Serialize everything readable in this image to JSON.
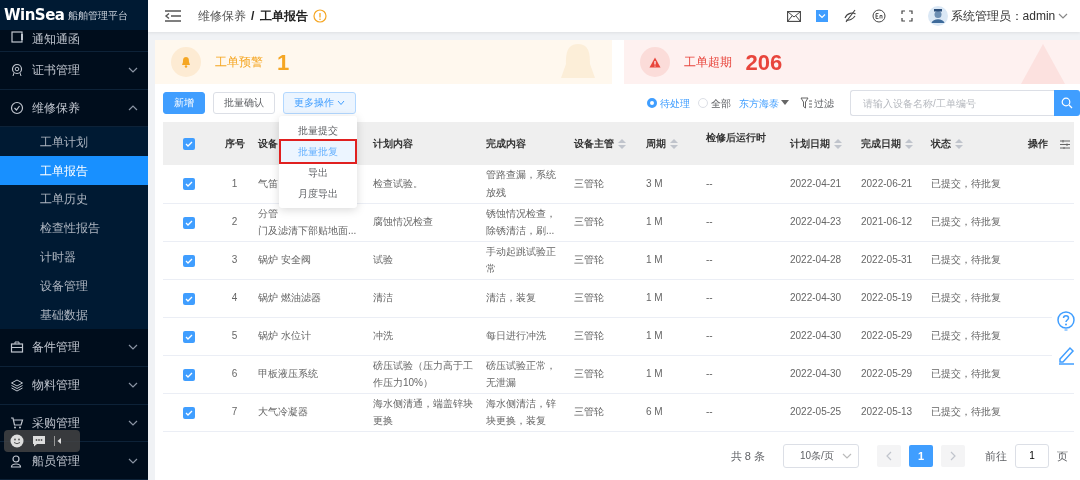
{
  "app": {
    "logo": "WinSea",
    "subtitle": "船舶管理平台"
  },
  "sidebar": {
    "items": [
      {
        "label": "通知通函",
        "kind": "link"
      },
      {
        "label": "证书管理",
        "kind": "group",
        "expanded": false
      },
      {
        "label": "维修保养",
        "kind": "group",
        "expanded": true,
        "children": [
          {
            "label": "工单计划",
            "selected": false
          },
          {
            "label": "工单报告",
            "selected": true
          },
          {
            "label": "工单历史",
            "selected": false
          },
          {
            "label": "检查性报告",
            "selected": false
          },
          {
            "label": "计时器",
            "selected": false
          },
          {
            "label": "设备管理",
            "selected": false
          },
          {
            "label": "基础数据",
            "selected": false
          }
        ]
      },
      {
        "label": "备件管理",
        "kind": "group",
        "expanded": false
      },
      {
        "label": "物料管理",
        "kind": "group",
        "expanded": false
      },
      {
        "label": "采购管理",
        "kind": "group",
        "expanded": false
      },
      {
        "label": "船员管理",
        "kind": "group",
        "expanded": false
      }
    ]
  },
  "header": {
    "breadcrumb": [
      "维修保养",
      "工单报告"
    ],
    "breadcrumb_separator": "/",
    "user": "系统管理员：admin"
  },
  "stats": [
    {
      "label": "工单预警",
      "value": "1",
      "kind": "warning"
    },
    {
      "label": "工单超期",
      "value": "206",
      "kind": "overdue"
    }
  ],
  "toolbar": {
    "buttons": [
      {
        "label": "新增",
        "kind": "primary"
      },
      {
        "label": "批量确认",
        "kind": "default"
      },
      {
        "label": "更多操作",
        "kind": "dropdown",
        "expanded": true
      }
    ],
    "menu": [
      {
        "label": "批量提交",
        "selected": false,
        "annotated": false
      },
      {
        "label": "批量批复",
        "selected": true,
        "annotated": true
      },
      {
        "label": "导出",
        "selected": false,
        "annotated": false
      },
      {
        "label": "月度导出",
        "selected": false,
        "annotated": false
      }
    ],
    "radios": [
      {
        "label": "待处理",
        "selected": true
      },
      {
        "label": "全部",
        "selected": false
      }
    ],
    "company": "东方海泰",
    "filter": "过滤",
    "search_placeholder": "请输入设备名称/工单编号"
  },
  "table": {
    "header_checked": true,
    "columns": [
      {
        "label": "序号",
        "sortable": false
      },
      {
        "label": "设备",
        "sortable": false
      },
      {
        "label": "计划内容",
        "sortable": false
      },
      {
        "label": "完成内容",
        "sortable": false
      },
      {
        "label": "设备主管",
        "sortable": true
      },
      {
        "label": "周期",
        "sortable": true
      },
      {
        "label": "检修后运行时",
        "sortable": false
      },
      {
        "label": "计划日期",
        "sortable": true
      },
      {
        "label": "完成日期",
        "sortable": true
      },
      {
        "label": "状态",
        "sortable": true
      },
      {
        "label": "操作",
        "sortable": false
      }
    ],
    "rows": [
      {
        "checked": true,
        "index": "1",
        "device": [
          "气笛"
        ],
        "plan": "检查试验。",
        "done": "管路查漏，系统放残",
        "manager": "三管轮",
        "cycle": "3 M",
        "runtime": "--",
        "plan_date": "2022-04-21",
        "done_date": "2022-06-21",
        "status": "已提交，待批复"
      },
      {
        "checked": true,
        "index": "2",
        "device": [
          "分管",
          "门及滤清下部贴地面..."
        ],
        "plan": "腐蚀情况检查",
        "done": "锈蚀情况检查，除锈清洁，刷...",
        "manager": "三管轮",
        "cycle": "1 M",
        "runtime": "--",
        "plan_date": "2022-04-23",
        "done_date": "2021-06-12",
        "status": "已提交，待批复"
      },
      {
        "checked": true,
        "index": "3",
        "device": [
          "锅炉 安全阀"
        ],
        "plan": "试验",
        "done": "手动起跳试验正常",
        "manager": "三管轮",
        "cycle": "1 M",
        "runtime": "--",
        "plan_date": "2022-04-28",
        "done_date": "2022-05-31",
        "status": "已提交，待批复"
      },
      {
        "checked": true,
        "index": "4",
        "device": [
          "锅炉 燃油滤器"
        ],
        "plan": "清洁",
        "done": "清洁，装复",
        "manager": "三管轮",
        "cycle": "1 M",
        "runtime": "--",
        "plan_date": "2022-04-30",
        "done_date": "2022-05-19",
        "status": "已提交，待批复"
      },
      {
        "checked": true,
        "index": "5",
        "device": [
          "锅炉 水位计"
        ],
        "plan": "冲洗",
        "done": "每日进行冲洗",
        "manager": "三管轮",
        "cycle": "1 M",
        "runtime": "--",
        "plan_date": "2022-04-30",
        "done_date": "2022-05-29",
        "status": "已提交，待批复"
      },
      {
        "checked": true,
        "index": "6",
        "device": [
          "甲板液压系统"
        ],
        "plan": "磅压试验（压力高于工作压力10%）",
        "done": "磅压试验正常，无泄漏",
        "manager": "三管轮",
        "cycle": "1 M",
        "runtime": "--",
        "plan_date": "2022-04-30",
        "done_date": "2022-05-29",
        "status": "已提交，待批复"
      },
      {
        "checked": true,
        "index": "7",
        "device": [
          "大气冷凝器"
        ],
        "plan": "海水侧清通，端盖锌块更换",
        "done": "海水侧清洁，锌块更换，装复",
        "manager": "三管轮",
        "cycle": "6 M",
        "runtime": "--",
        "plan_date": "2022-05-25",
        "done_date": "2022-05-13",
        "status": "已提交，待批复"
      }
    ]
  },
  "pagination": {
    "total": "共 8 条",
    "page_size": "10条/页",
    "pages": [
      {
        "label": "1",
        "selected": true
      }
    ],
    "goto_label": "前往",
    "goto_value": "1",
    "goto_suffix": "页"
  }
}
